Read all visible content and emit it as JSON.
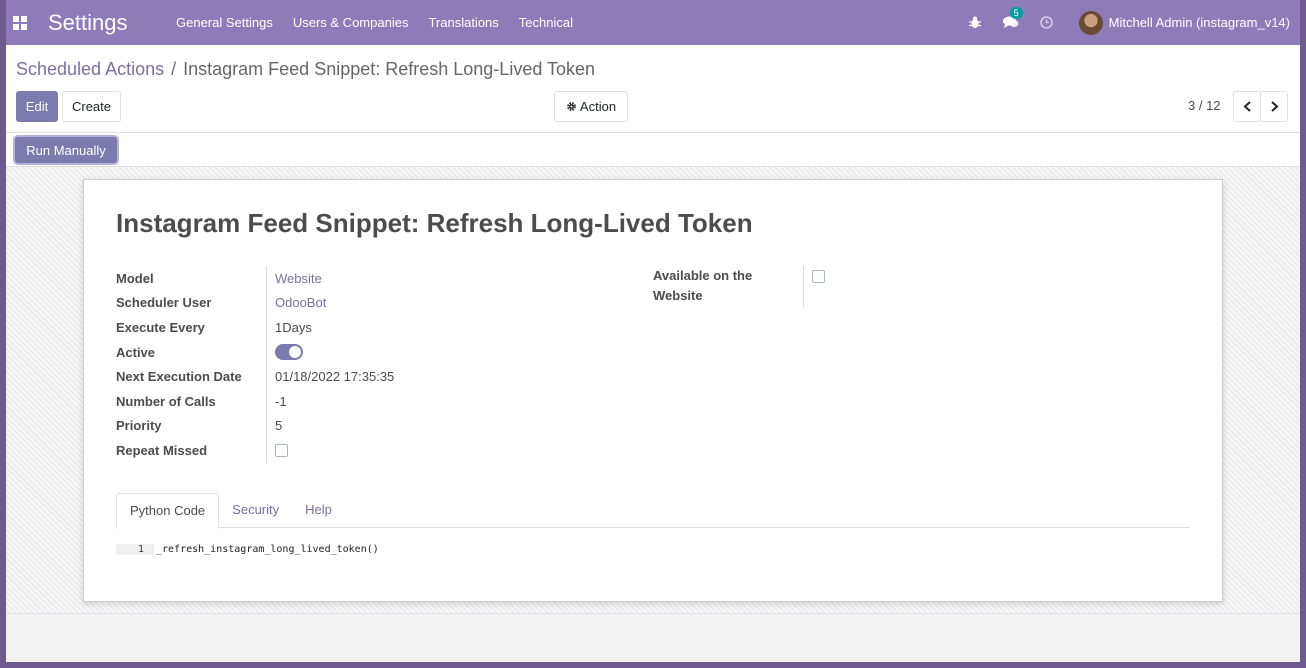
{
  "navbar": {
    "app_title": "Settings",
    "menu": [
      "General Settings",
      "Users & Companies",
      "Translations",
      "Technical"
    ],
    "messages_badge": "5",
    "user_name": "Mitchell Admin (instagram_v14)"
  },
  "breadcrumb": {
    "parent": "Scheduled Actions",
    "separator": "/",
    "current": "Instagram Feed Snippet: Refresh Long-Lived Token"
  },
  "buttons": {
    "edit": "Edit",
    "create": "Create",
    "action": "Action",
    "run_manually": "Run Manually"
  },
  "pager": {
    "value": "3 / 12"
  },
  "record": {
    "title": "Instagram Feed Snippet: Refresh Long-Lived Token",
    "fields": {
      "model_label": "Model",
      "model_value": "Website",
      "user_label": "Scheduler User",
      "user_value": "OdooBot",
      "interval_label": "Execute Every",
      "interval_value": "1Days",
      "active_label": "Active",
      "nextcall_label": "Next Execution Date",
      "nextcall_value": "01/18/2022 17:35:35",
      "numcall_label": "Number of Calls",
      "numcall_value": "-1",
      "priority_label": "Priority",
      "priority_value": "5",
      "repeat_label": "Repeat Missed",
      "website_label": "Available on the Website"
    },
    "active": true,
    "repeat_missed": false,
    "available_on_website": false
  },
  "tabs": [
    "Python Code",
    "Security",
    "Help"
  ],
  "code": {
    "line_number": "1",
    "line": "_refresh_instagram_long_lived_token()"
  },
  "colors": {
    "navbar": "#8e7cb8",
    "primary": "#7c7bad",
    "link": "#7c6f9f"
  }
}
